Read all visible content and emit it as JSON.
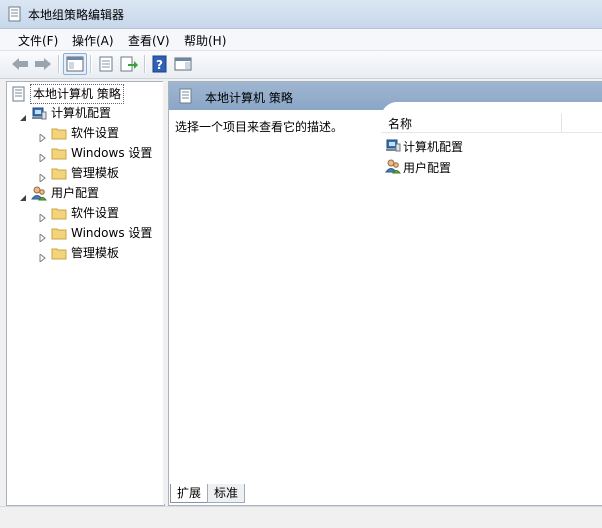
{
  "window": {
    "title": "本地组策略编辑器"
  },
  "menu": [
    {
      "label": "文件(F)"
    },
    {
      "label": "操作(A)"
    },
    {
      "label": "查看(V)"
    },
    {
      "label": "帮助(H)"
    }
  ],
  "toolbar": {
    "buttons": [
      "back-arrow-icon",
      "forward-arrow-icon",
      "show-hide-tree-icon",
      "properties-icon",
      "export-list-icon",
      "help-icon",
      "show-hide-action-pane-icon"
    ]
  },
  "tree": {
    "root": "本地计算机 策略",
    "computer": "计算机配置",
    "computer_children": [
      "软件设置",
      "Windows 设置",
      "管理模板"
    ],
    "user": "用户配置",
    "user_children": [
      "软件设置",
      "Windows 设置",
      "管理模板"
    ]
  },
  "detail": {
    "header": "本地计算机 策略",
    "description": "选择一个项目来查看它的描述。",
    "column_name": "名称",
    "items": [
      "计算机配置",
      "用户配置"
    ]
  },
  "tabs": {
    "extended": "扩展",
    "standard": "标准"
  },
  "colors": {
    "header_blue": "#8aa6c6",
    "folder_yellow": "#f2d47c",
    "help_blue": "#2f5fb6"
  }
}
